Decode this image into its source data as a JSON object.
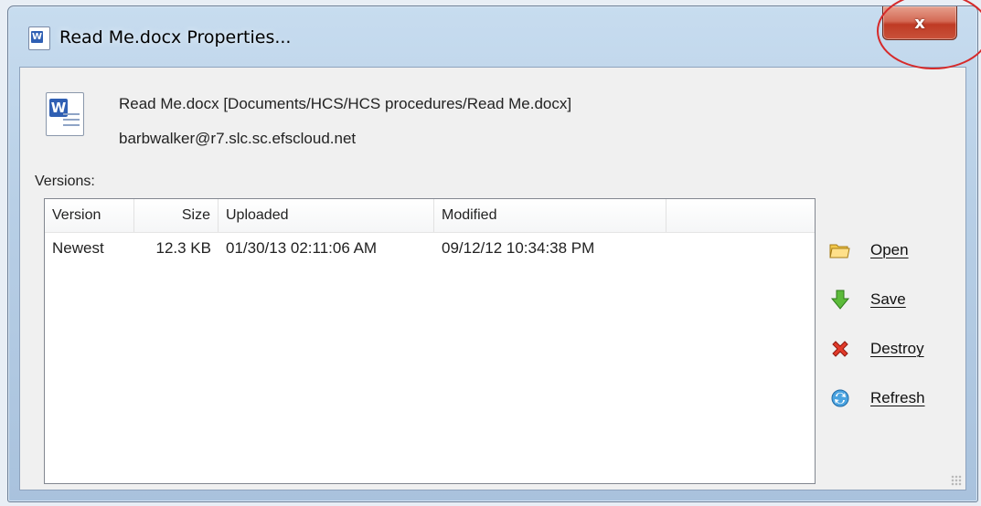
{
  "window": {
    "title": "Read Me.docx Properties...",
    "close_glyph": "x"
  },
  "file_info": {
    "name_and_path": "Read Me.docx [Documents/HCS/HCS procedures/Read Me.docx]",
    "account": "barbwalker@r7.slc.sc.efscloud.net"
  },
  "versions": {
    "label": "Versions:",
    "columns": [
      "Version",
      "Size",
      "Uploaded",
      "Modified"
    ],
    "rows": [
      {
        "version": "Newest",
        "size": "12.3 KB",
        "uploaded": "01/30/13 02:11:06 AM",
        "modified": "09/12/12 10:34:38 PM"
      }
    ]
  },
  "actions": [
    {
      "label": "Open",
      "icon": "folder-icon"
    },
    {
      "label": "Save",
      "icon": "green-arrow-icon"
    },
    {
      "label": "Destroy",
      "icon": "red-x-icon"
    },
    {
      "label": "Refresh",
      "icon": "refresh-icon"
    }
  ],
  "colors": {
    "annotation": "#d62a2a",
    "close_button": "#c9523a"
  }
}
